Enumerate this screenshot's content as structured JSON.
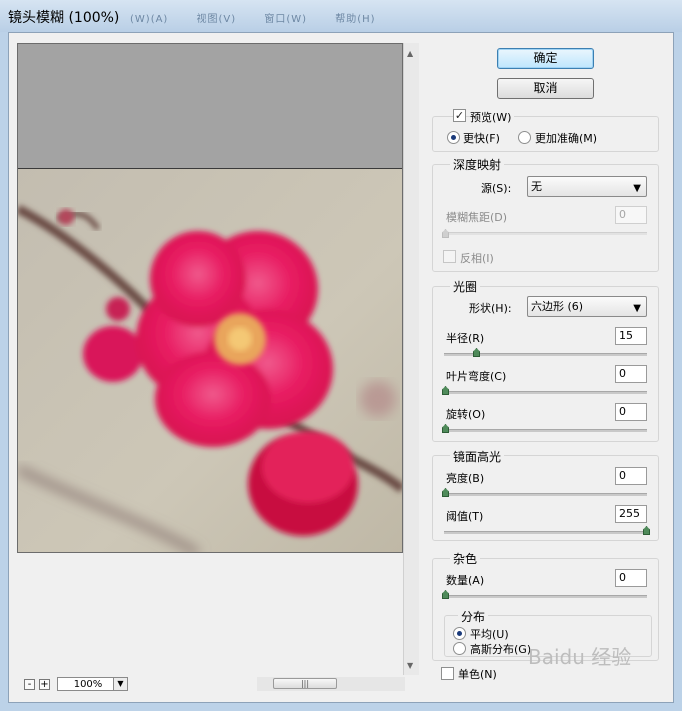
{
  "window": {
    "title": "镜头模糊 (100%)",
    "menus": [
      "(W)(A)",
      "视图(V)",
      "窗口(W)",
      "帮助(H)"
    ]
  },
  "preview": {
    "zoom": "100%",
    "zoom_out": "-",
    "zoom_in": "+"
  },
  "buttons": {
    "ok": "确定",
    "cancel": "取消"
  },
  "preview_opts": {
    "preview_label": "预览(W)",
    "faster_label": "更快(F)",
    "accurate_label": "更加准确(M)"
  },
  "depth_map": {
    "title": "深度映射",
    "source_label": "源(S):",
    "source_value": "无",
    "blur_focal_label": "模糊焦距(D)",
    "blur_focal_value": "0",
    "invert_label": "反相(I)"
  },
  "iris": {
    "title": "光圈",
    "shape_label": "形状(H):",
    "shape_value": "六边形 (6)",
    "radius_label": "半径(R)",
    "radius_value": "15",
    "blade_label": "叶片弯度(C)",
    "blade_value": "0",
    "rotation_label": "旋转(O)",
    "rotation_value": "0"
  },
  "specular": {
    "title": "镜面高光",
    "brightness_label": "亮度(B)",
    "brightness_value": "0",
    "threshold_label": "阈值(T)",
    "threshold_value": "255"
  },
  "noise": {
    "title": "杂色",
    "amount_label": "数量(A)",
    "amount_value": "0",
    "distribution_title": "分布",
    "uniform_label": "平均(U)",
    "gaussian_label": "高斯分布(G)",
    "mono_label": "单色(N)"
  },
  "watermark": "Baidu 经验",
  "colors": {
    "blossom": "#e8175d",
    "background": "#c9c2b0",
    "button_default": "#bee6fd"
  }
}
